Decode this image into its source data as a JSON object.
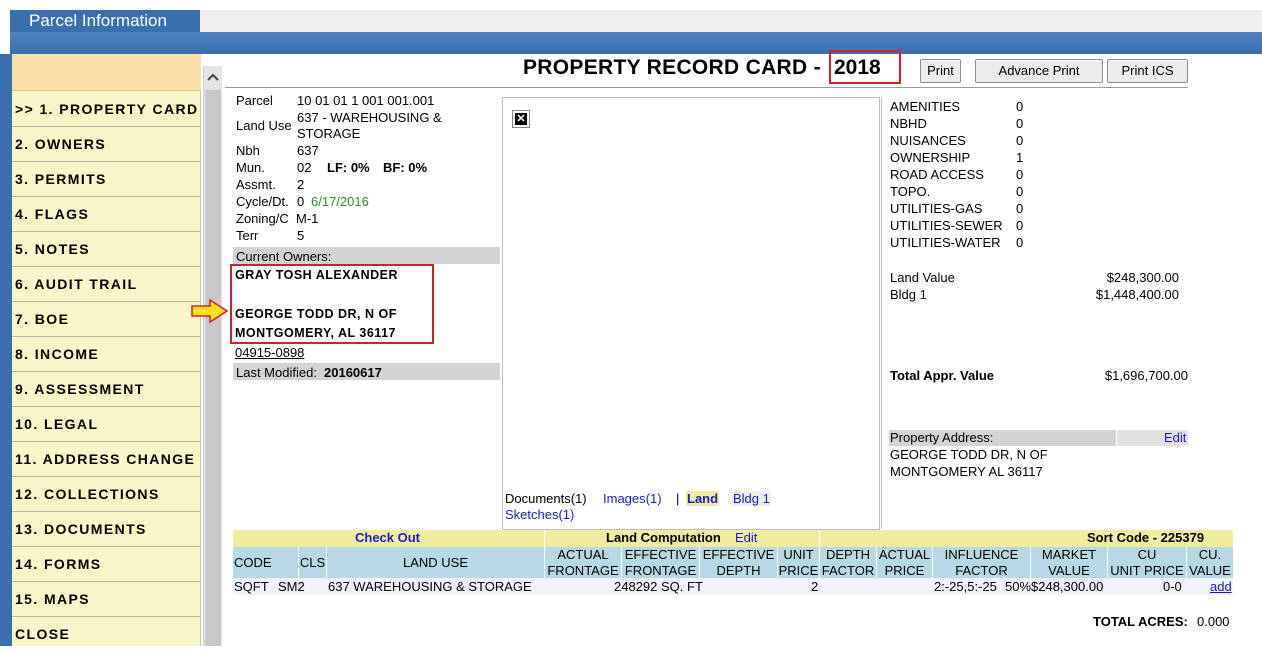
{
  "app": {
    "tab_title": "Parcel Information"
  },
  "sidebar": {
    "items": [
      {
        "label": ">> 1. PROPERTY CARD"
      },
      {
        "label": "2. OWNERS"
      },
      {
        "label": "3. PERMITS"
      },
      {
        "label": "4. FLAGS"
      },
      {
        "label": "5. NOTES"
      },
      {
        "label": "6. AUDIT TRAIL"
      },
      {
        "label": "7. BOE"
      },
      {
        "label": "8. INCOME"
      },
      {
        "label": "9. ASSESSMENT"
      },
      {
        "label": "10. LEGAL"
      },
      {
        "label": "11. ADDRESS CHANGE"
      },
      {
        "label": "12. COLLECTIONS"
      },
      {
        "label": "13. DOCUMENTS"
      },
      {
        "label": "14. FORMS"
      },
      {
        "label": "15. MAPS"
      },
      {
        "label": "CLOSE"
      }
    ]
  },
  "card": {
    "title": "PROPERTY RECORD CARD - ",
    "year": "2018",
    "buttons": {
      "print": "Print",
      "advance_print": "Advance Print",
      "print_ics": "Print ICS"
    }
  },
  "parcel": {
    "parcel_label": "Parcel",
    "parcel_value": "10 01 01 1 001 001.001",
    "land_use_label": "Land Use",
    "land_use_value_1": "637 - WAREHOUSING &",
    "land_use_value_2": "STORAGE",
    "nbh_label": "Nbh",
    "nbh_value": "637",
    "mun_label": "Mun.",
    "mun_value": "02",
    "lf": "LF: 0%",
    "bf": "BF: 0%",
    "assmt_label": "Assmt.",
    "assmt_value": "2",
    "cycle_label": "Cycle/Dt.",
    "cycle_value": "0",
    "cycle_date": "6/17/2016",
    "zoning_label": "Zoning/C",
    "zoning_value": "M-1",
    "terr_label": "Terr",
    "terr_value": "5",
    "current_owners_label": "Current Owners:",
    "owner_name": "GRAY TOSH ALEXANDER",
    "owner_addr1": "GEORGE TODD DR, N OF",
    "owner_addr2": "MONTGOMERY, AL   36117",
    "owner_id": "04915-0898",
    "last_modified_label": "Last Modified:",
    "last_modified_value": "20160617"
  },
  "media": {
    "documents": "Documents(1)",
    "images": "Images(1)",
    "sep": "|",
    "land": "Land",
    "bldg": "Bldg 1",
    "sketches": "Sketches(1)"
  },
  "adjustments": [
    {
      "label": "AMENITIES",
      "value": "0"
    },
    {
      "label": "NBHD",
      "value": "0"
    },
    {
      "label": "NUISANCES",
      "value": "0"
    },
    {
      "label": "OWNERSHIP",
      "value": "1"
    },
    {
      "label": "ROAD ACCESS",
      "value": "0"
    },
    {
      "label": "TOPO.",
      "value": "0"
    },
    {
      "label": "UTILITIES-GAS",
      "value": "0"
    },
    {
      "label": "UTILITIES-SEWER",
      "value": "0"
    },
    {
      "label": "UTILITIES-WATER",
      "value": "0"
    }
  ],
  "values": {
    "land_label": "Land Value",
    "land_value": "$248,300.00",
    "bldg_label": "Bldg 1",
    "bldg_value": "$1,448,400.00",
    "total_label": "Total Appr. Value",
    "total_value": "$1,696,700.00"
  },
  "property_address": {
    "label": "Property Address:",
    "edit": "Edit",
    "line1": "GEORGE TODD DR, N OF",
    "line2": "MONTGOMERY AL 36117"
  },
  "land_computation": {
    "check_out": "Check Out",
    "title": "Land Computation",
    "edit": "Edit",
    "sort_code": "Sort Code - 225379",
    "headers": {
      "code": "CODE",
      "cls": "CLS",
      "land_use": "LAND USE",
      "actual_frontage_1": "ACTUAL",
      "actual_frontage_2": "FRONTAGE",
      "eff_frontage_1": "EFFECTIVE",
      "eff_frontage_2": "FRONTAGE",
      "eff_depth_1": "EFFECTIVE",
      "eff_depth_2": "DEPTH",
      "unit_price_1": "UNIT",
      "unit_price_2": "PRICE",
      "depth_factor_1": "DEPTH",
      "depth_factor_2": "FACTOR",
      "actual_price_1": "ACTUAL",
      "actual_price_2": "PRICE",
      "influence_1": "INFLUENCE",
      "influence_2": "FACTOR",
      "market_1": "MARKET",
      "market_2": "VALUE",
      "cu_unit_1": "CU",
      "cu_unit_2": "UNIT PRICE",
      "cu_value_1": "CU.",
      "cu_value_2": "VALUE"
    },
    "row": {
      "code": "SQFT",
      "cls": "SM2",
      "land_use": "637 WAREHOUSING & STORAGE",
      "frontage": "248292 SQ. FT",
      "unit_price": "2",
      "influence": "2:-25,5:-25",
      "pct": "50%",
      "market_value": "$248,300.00",
      "cu": "0-0",
      "add": "add"
    },
    "total_acres_label": "TOTAL ACRES:",
    "total_acres_value": "0.000"
  }
}
